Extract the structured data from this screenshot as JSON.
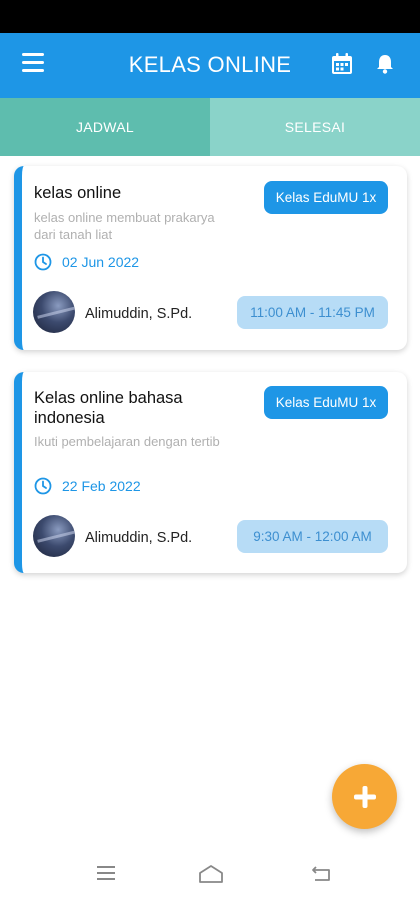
{
  "app_bar": {
    "title": "KELAS ONLINE",
    "menu_icon": "hamburger-menu-icon",
    "calendar_icon": "calendar-icon",
    "notification_icon": "bell-icon",
    "color": "#1e96e6"
  },
  "tabs": [
    {
      "label": "JADWAL",
      "active": true,
      "color": "#5ebdae"
    },
    {
      "label": "SELESAI",
      "active": false,
      "color": "#8ad3c9"
    }
  ],
  "classes": [
    {
      "title": "kelas online",
      "badge": "Kelas EduMU 1x",
      "description": "kelas online membuat prakarya dari tanah liat",
      "date": "02 Jun 2022",
      "teacher": "Alimuddin, S.Pd.",
      "time": "11:00 AM - 11:45 PM"
    },
    {
      "title": "Kelas online bahasa indonesia",
      "badge": "Kelas EduMU 1x",
      "description": "Ikuti pembelajaran dengan tertib",
      "date": "22 Feb 2022",
      "teacher": "Alimuddin, S.Pd.",
      "time": "9:30 AM - 12:00 AM"
    }
  ],
  "fab": {
    "icon": "plus-icon",
    "color": "#f7a836"
  },
  "nav_bar": {
    "recents_icon": "recents-icon",
    "home_icon": "home-icon",
    "back_icon": "back-icon"
  }
}
